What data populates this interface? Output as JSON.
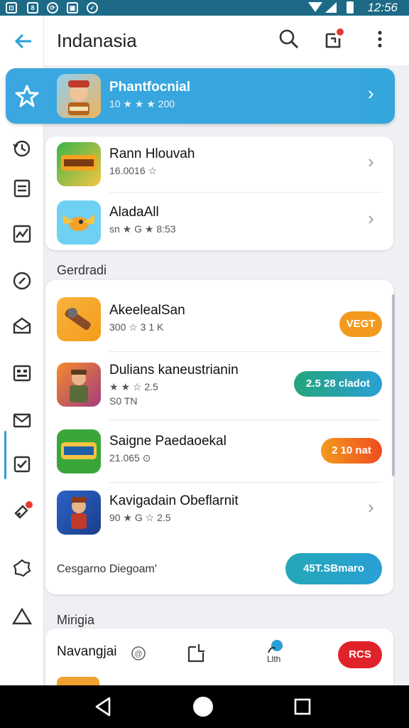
{
  "status_bar": {
    "time": "12:56",
    "icons": [
      "notification-icon",
      "data-icon",
      "sync-icon",
      "image-icon",
      "chat-icon",
      "wifi-icon",
      "signal-icon",
      "battery-icon"
    ]
  },
  "header": {
    "title": "Indanasia",
    "back_icon": "arrow-left-icon",
    "search_icon": "search-icon",
    "inbox_icon": "inbox-icon",
    "more_icon": "more-vertical-icon"
  },
  "featured": {
    "name": "Phantfocnial",
    "meta": "10 ★ ★ ★ 200",
    "icon": "star-icon"
  },
  "top_list": [
    {
      "name": "Rann Hlouvah",
      "meta": "16.0016 ☆",
      "icon_color": "#2aa84a"
    },
    {
      "name": "AladaAll",
      "meta": "sn ★ G ★ 8:53",
      "icon_color": "#4cc0f0"
    }
  ],
  "section_1": {
    "title": "Gerdradi",
    "items": [
      {
        "name": "AkeelealSan",
        "meta": "300 ☆ 3 1 K",
        "meta2": "",
        "action": "VEGT",
        "action_color": "#f39a1e"
      },
      {
        "name": "Dulians kaneustrianin",
        "meta": "★ ★ ☆ 2.5",
        "meta2": "S0 TN",
        "action": "2.5 28 cladot",
        "action_color": "#2a9fd6"
      },
      {
        "name": "Saigne Paedaoekal",
        "meta": "21.065 ⊙",
        "meta2": "",
        "action": "2 10 nat",
        "action_color": "#f0611e"
      },
      {
        "name": "Kavigadain Obeflarnit",
        "meta": "90 ★ G ☆ 2.5",
        "meta2": "",
        "action": "",
        "action_color": ""
      }
    ],
    "footer_text": "Cesgarno Diegoam'",
    "footer_action": "45T.SBmaro"
  },
  "section_2": {
    "title": "Mirigia",
    "nav_label": "Navangjai",
    "nav_icon_label": "Llth",
    "nav_action": "RCS"
  },
  "sidebar": {
    "icons": [
      "star-icon",
      "history-icon",
      "document-icon",
      "chart-icon",
      "compass-icon",
      "mail-open-icon",
      "grid-icon",
      "mail-icon",
      "checkbox-icon",
      "tag-icon",
      "settings-icon",
      "alert-icon"
    ]
  },
  "system_nav": [
    "back-icon",
    "home-icon",
    "recents-icon"
  ]
}
